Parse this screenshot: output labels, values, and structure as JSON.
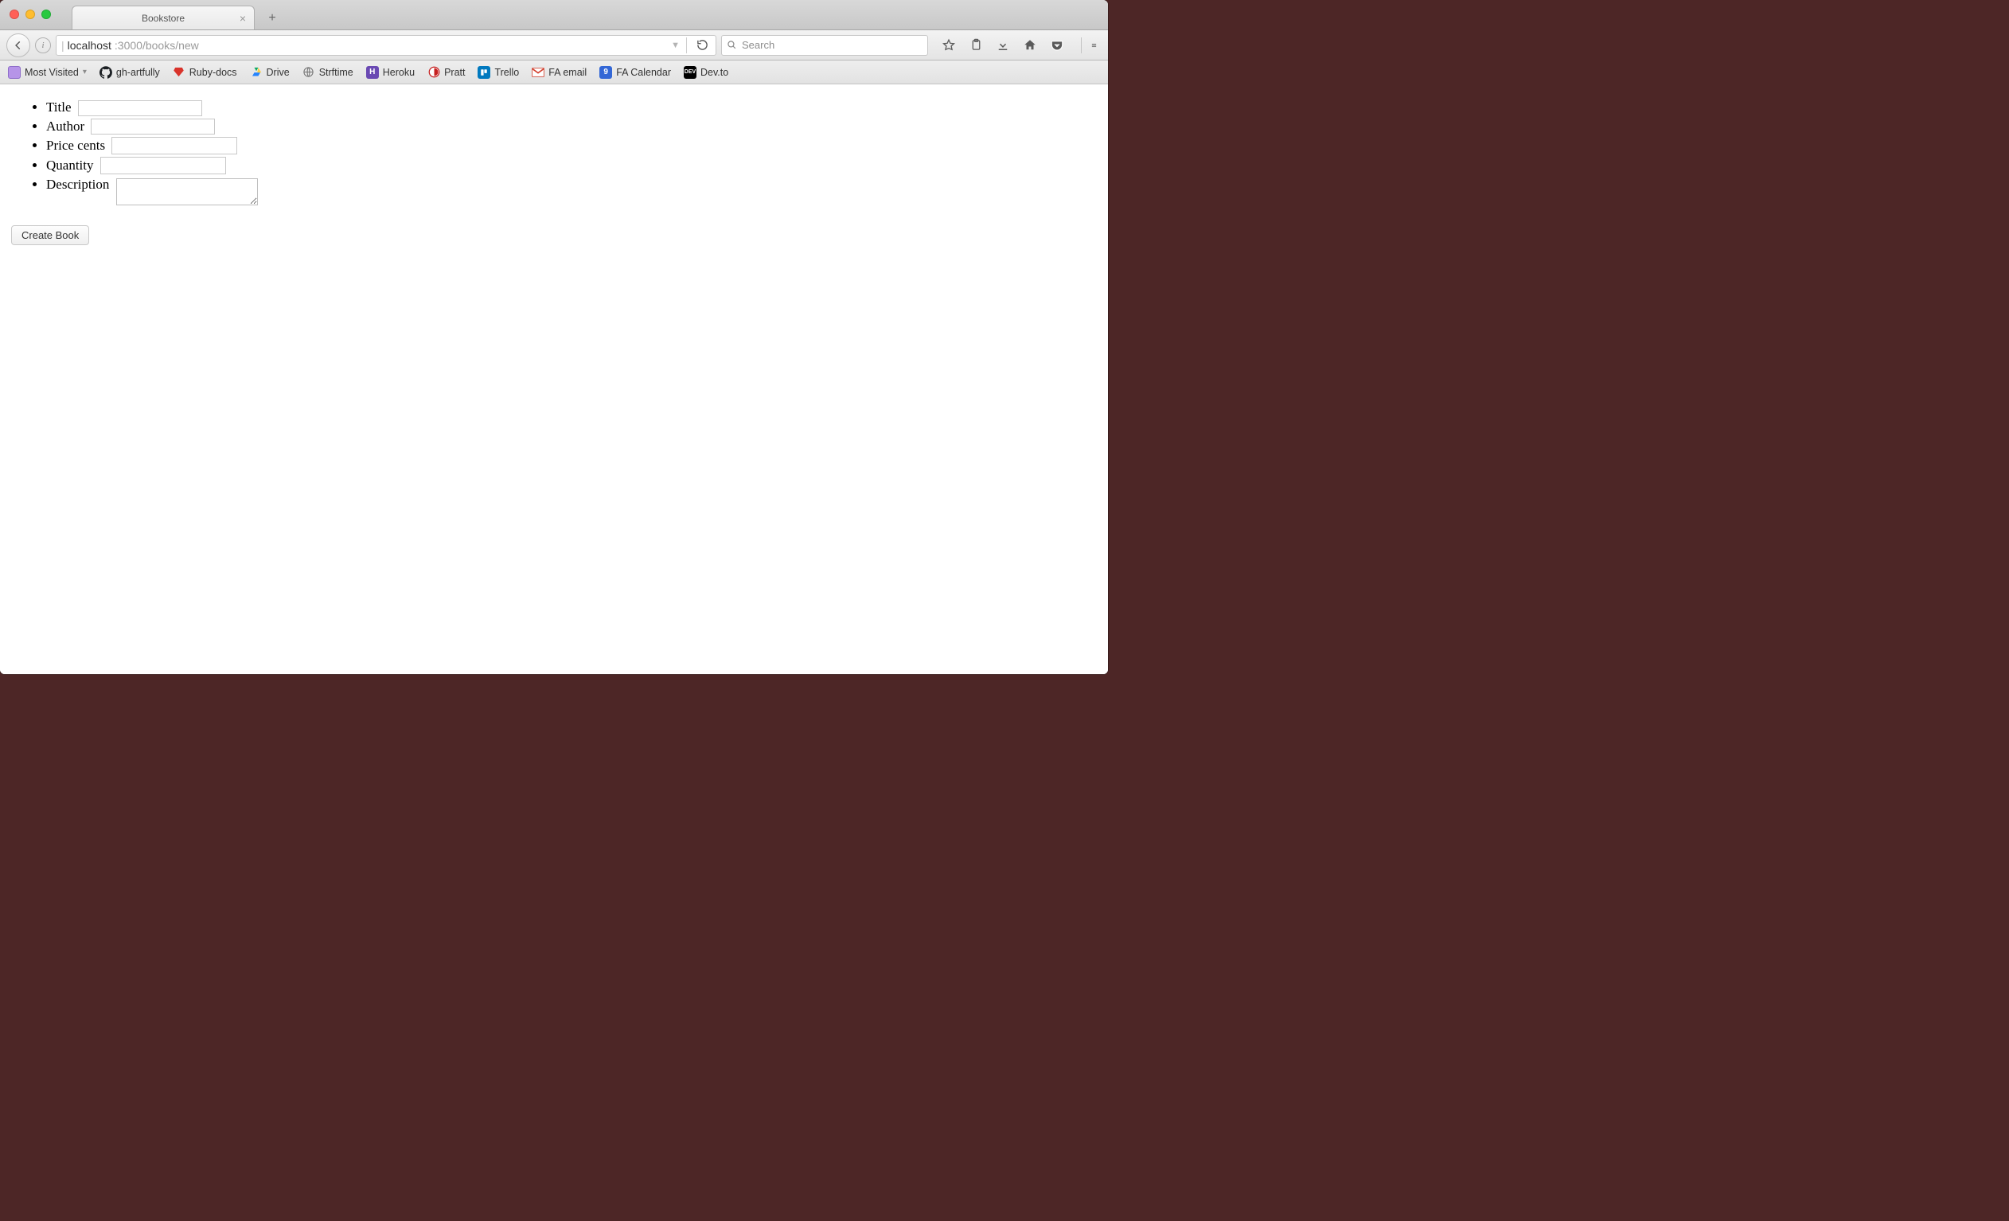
{
  "tab": {
    "title": "Bookstore"
  },
  "url": {
    "host": "localhost",
    "port_path": ":3000/books/new"
  },
  "search": {
    "placeholder": "Search"
  },
  "bookmarks": [
    {
      "label": "Most Visited",
      "icon": "most-visited",
      "dropdown": true
    },
    {
      "label": "gh-artfully",
      "icon": "github"
    },
    {
      "label": "Ruby-docs",
      "icon": "ruby"
    },
    {
      "label": "Drive",
      "icon": "drive"
    },
    {
      "label": "Strftime",
      "icon": "globe"
    },
    {
      "label": "Heroku",
      "icon": "heroku"
    },
    {
      "label": "Pratt",
      "icon": "pratt"
    },
    {
      "label": "Trello",
      "icon": "trello"
    },
    {
      "label": "FA email",
      "icon": "gmail"
    },
    {
      "label": "FA Calendar",
      "icon": "calendar"
    },
    {
      "label": "Dev.to",
      "icon": "devto"
    }
  ],
  "form": {
    "fields": {
      "title": {
        "label": "Title",
        "value": ""
      },
      "author": {
        "label": "Author",
        "value": ""
      },
      "price_cents": {
        "label": "Price cents",
        "value": ""
      },
      "quantity": {
        "label": "Quantity",
        "value": ""
      },
      "description": {
        "label": "Description",
        "value": ""
      }
    },
    "submit_label": "Create Book"
  }
}
